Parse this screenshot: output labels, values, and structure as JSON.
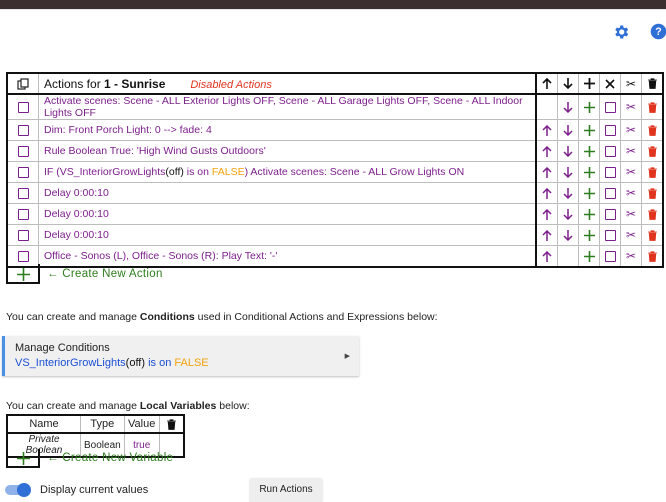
{
  "header": {
    "settings_icon": "gear-icon",
    "help_icon": "help-icon"
  },
  "actions_table": {
    "prefix": "Actions for ",
    "rule_name": "1 - Sunrise",
    "disabled_label": "Disabled Actions",
    "header_icons": [
      "copy-icon",
      "arrow-up-icon",
      "arrow-down-icon",
      "plus-icon",
      "close-icon",
      "scissors-icon",
      "trash-icon"
    ],
    "rows": [
      {
        "text": "Activate scenes: Scene - ALL Exterior Lights OFF, Scene - ALL Garage Lights OFF, Scene - ALL Indoor Lights OFF"
      },
      {
        "text": "Dim: Front Porch Light: 0 --> fade: 4"
      },
      {
        "text": "Rule Boolean True: 'High Wind Gusts Outdoors'"
      },
      {
        "pre": "IF (VS_InteriorGrowLights",
        "var": "(off)",
        "mid": " is on ",
        "val": "FALSE",
        "post": ") Activate scenes: Scene - ALL Grow  Lights ON"
      },
      {
        "text": "Delay 0:00:10"
      },
      {
        "text": "Delay 0:00:10"
      },
      {
        "text": "Delay 0:00:10"
      },
      {
        "text": "Office - Sonos (L), Office - Sonos (R): Play Text: '-'"
      }
    ],
    "create_label": "← Create New Action"
  },
  "conditions": {
    "intro_pre": "You can create and manage ",
    "intro_bold": "Conditions",
    "intro_post": " used in Conditional Actions and Expressions below:",
    "manage_label": "Manage Conditions",
    "summary_name": "VS_InteriorGrowLights",
    "summary_var": "(off)",
    "summary_mid": " is on ",
    "summary_val": "FALSE"
  },
  "variables": {
    "intro_pre": "You can create and manage ",
    "intro_bold": "Local Variables",
    "intro_post": " below:",
    "headers": {
      "name": "Name",
      "type": "Type",
      "value": "Value"
    },
    "rows": [
      {
        "name": "Private Boolean",
        "type": "Boolean",
        "value": "true"
      }
    ],
    "create_label": "← Create New Variable"
  },
  "footer": {
    "display_label": "Display current values",
    "display_on": true,
    "run_label": "Run Actions"
  },
  "colors": {
    "purple": "#7d1f8c",
    "green": "#2e7d1e",
    "red": "#e0341f",
    "orange": "#f2a20d",
    "blue": "#1a4fd6"
  }
}
